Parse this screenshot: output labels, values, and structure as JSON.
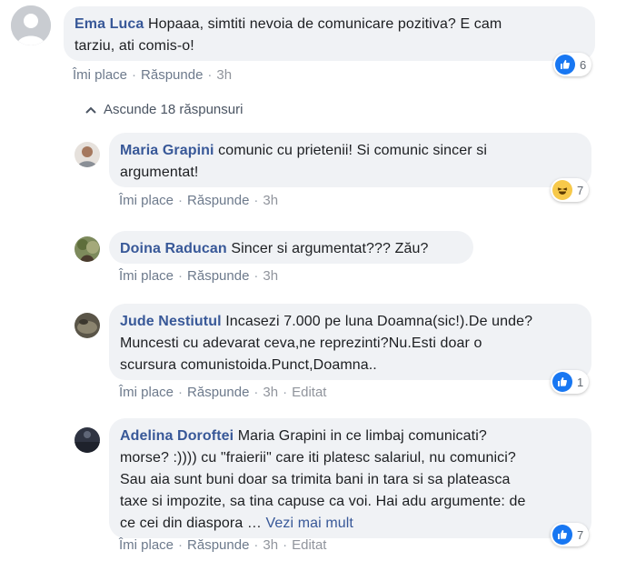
{
  "colors": {
    "author": "#385898",
    "bubble": "#f0f2f5",
    "like": "#1877f2",
    "haha": "#f7c94a"
  },
  "main_comment": {
    "author": "Ema Luca",
    "text_line1": "Hopaaa, simtiti nevoia de comunicare pozitiva? E cam",
    "text_line2": "tarziu, ati comis-o!",
    "like": "Îmi place",
    "reply": "Răspunde",
    "time": "3h",
    "reaction_icon": "like-icon",
    "reaction_count": "6"
  },
  "collapse_label": "Ascunde 18 răspunsuri",
  "replies": [
    {
      "author": "Maria Grapini",
      "text_line1": "comunic cu prietenii! Si comunic sincer si",
      "text_line2": "argumentat!",
      "like": "Îmi place",
      "reply": "Răspunde",
      "time": "3h",
      "reaction_icon": "haha-icon",
      "reaction_count": "7"
    },
    {
      "author": "Doina Raducan",
      "text_line1": "Sincer si argumentat??? Zău?",
      "like": "Îmi place",
      "reply": "Răspunde",
      "time": "3h"
    },
    {
      "author": "Jude Nestiutul",
      "text_line1": "Incasezi 7.000 pe luna Doamna(sic!).De unde?",
      "text_line2": "Muncesti cu adevarat ceva,ne reprezinti?Nu.Esti doar o",
      "text_line3": "scursura comunistoida.Punct,Doamna..",
      "like": "Îmi place",
      "reply": "Răspunde",
      "time": "3h",
      "edited": "Editat",
      "reaction_icon": "like-icon",
      "reaction_count": "1"
    },
    {
      "author": "Adelina Doroftei",
      "text_line1": "Maria Grapini in ce limbaj comunicati?",
      "text_line2": "morse? :)))) cu \"fraierii\" care iti platesc salariul, nu comunici?",
      "text_line3": "Sau aia sunt buni doar sa trimita bani in tara si sa plateasca",
      "text_line4": "taxe si impozite, sa tina capuse ca voi. Hai adu argumente: de",
      "text_line5": "ce cei din diaspora …",
      "see_more": "Vezi mai mult",
      "like": "Îmi place",
      "reply": "Răspunde",
      "time": "3h",
      "edited": "Editat",
      "reaction_icon": "like-icon",
      "reaction_count": "7"
    }
  ]
}
